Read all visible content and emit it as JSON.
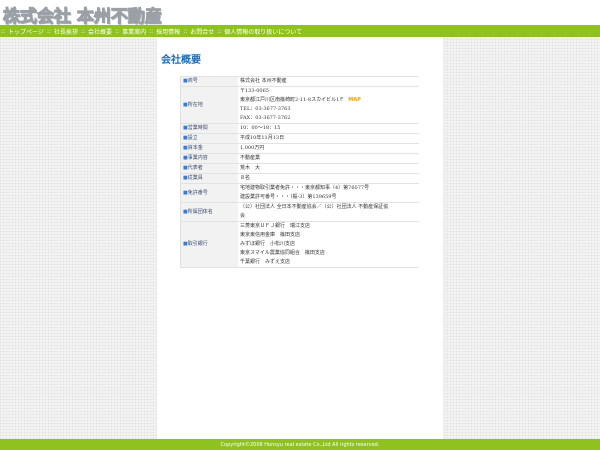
{
  "header": {
    "site_title": "株式会社 本州不動産"
  },
  "nav": {
    "items": [
      "トップページ",
      "社長挨拶",
      "会社概要",
      "事業案内",
      "採用情報",
      "お問合せ",
      "個人情報の取り扱いについて"
    ],
    "separator": "::"
  },
  "main": {
    "title": "会社概要",
    "rows": [
      {
        "label": "商号",
        "lines": [
          "株式会社 本州不動産"
        ]
      },
      {
        "label": "所在地",
        "lines": [
          "〒133-0065",
          "東京都江戸川区南篠崎町2-11-8スカイビル1Ｆ",
          "TEL：03-3677-3763",
          "FAX：03-3677-3762"
        ],
        "link": "MAP"
      },
      {
        "label": "営業時間",
        "lines": [
          "10：00～18：15"
        ]
      },
      {
        "label": "設立",
        "lines": [
          "平成10年11月13日"
        ]
      },
      {
        "label": "資本金",
        "lines": [
          "1,000万円"
        ]
      },
      {
        "label": "事業内容",
        "lines": [
          "不動産業"
        ]
      },
      {
        "label": "代表者",
        "lines": [
          "荒木　大"
        ]
      },
      {
        "label": "従業員",
        "lines": [
          "８名"
        ]
      },
      {
        "label": "免許番号",
        "lines": [
          "宅地建物取引業者免許・・・東京都知事（4）第76077号",
          "建設業許可番号・・・（般-3）第139659号"
        ]
      },
      {
        "label": "所属団体名",
        "lines": [
          "（公）社団法人 全日本不動産協会／（公）社団法人 不動産保証協",
          "会"
        ]
      },
      {
        "label": "取引銀行",
        "lines": [
          "三菱東京ＵＦＪ銀行　瑞江支店",
          "東京東信用金庫　篠田支店",
          "みずほ銀行　小松川支店",
          "東京スマイル農業協同組合　篠田支店",
          "千葉銀行　みずえ支店"
        ]
      }
    ]
  },
  "footer": {
    "copyright": "Copyright©2008 Honsyu real estate Co.,Ltd All rights reserved."
  },
  "colors": {
    "accent_green": "#8fc21f",
    "title_blue": "#1e6fb8",
    "map_orange": "#f0a000"
  }
}
